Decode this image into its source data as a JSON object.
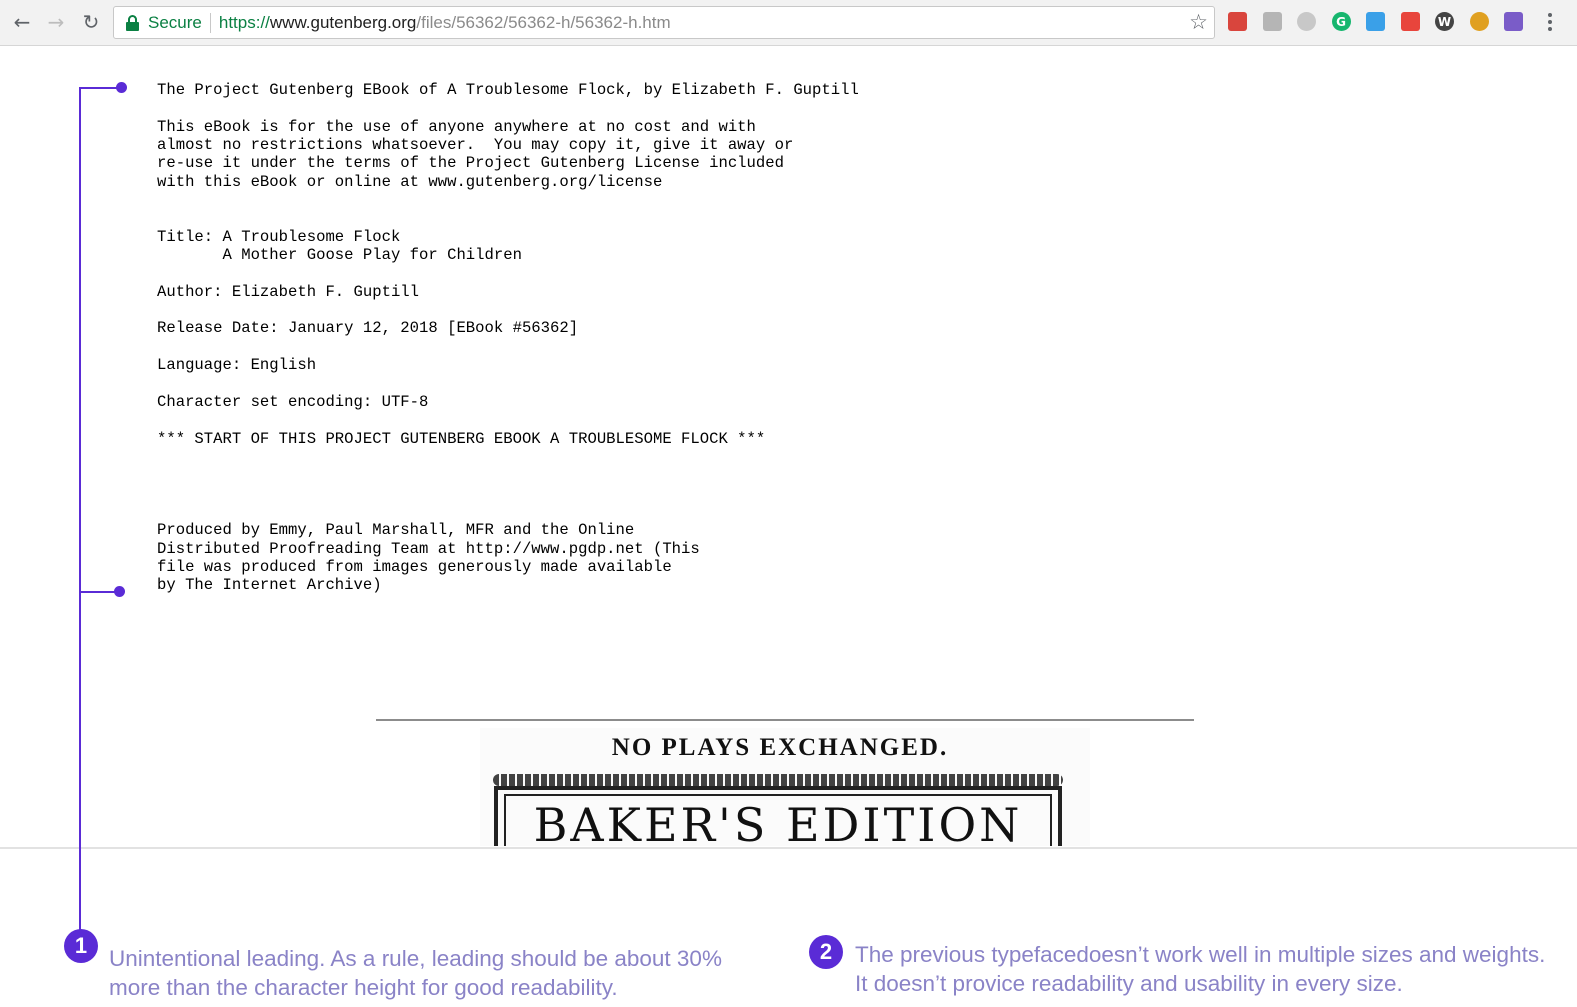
{
  "browser": {
    "secure_label": "Secure",
    "url_scheme": "https://",
    "url_host": "www.gutenberg.org",
    "url_path": "/files/56362/56362-h/56362-h.htm",
    "extensions": [
      {
        "name": "bookmark-red-icon",
        "color": "#d9453d"
      },
      {
        "name": "grey-folder-icon",
        "color": "#b5b5b5"
      },
      {
        "name": "drive-icon",
        "color": "#c8c8c8"
      },
      {
        "name": "grammarly-icon",
        "color": "#16b66e",
        "glyph": "G"
      },
      {
        "name": "notes-icon",
        "color": "#3aa0e8"
      },
      {
        "name": "color-check-icon",
        "color": "#e8453c"
      },
      {
        "name": "wordpress-icon",
        "color": "#444444",
        "glyph": "W"
      },
      {
        "name": "color-wheel-icon",
        "color": "#e0a020"
      },
      {
        "name": "dropper-icon",
        "color": "#7a5cc8"
      }
    ]
  },
  "ebook": {
    "header": "The Project Gutenberg EBook of A Troublesome Flock, by Elizabeth F. Guptill",
    "license": "This eBook is for the use of anyone anywhere at no cost and with\nalmost no restrictions whatsoever.  You may copy it, give it away or\nre-use it under the terms of the Project Gutenberg License included\nwith this eBook or online at www.gutenberg.org/license",
    "title": "Title: A Troublesome Flock\n       A Mother Goose Play for Children",
    "author": "Author: Elizabeth F. Guptill",
    "release": "Release Date: January 12, 2018 [EBook #56362]",
    "language": "Language: English",
    "encoding": "Character set encoding: UTF-8",
    "start_marker": "*** START OF THIS PROJECT GUTENBERG EBOOK A TROUBLESOME FLOCK ***",
    "produced_by": "Produced by Emmy, Paul Marshall, MFR and the Online\nDistributed Proofreading Team at http://www.pgdp.net (This\nfile was produced from images generously made available\nby The Internet Archive)"
  },
  "book_image": {
    "heading": "NO PLAYS EXCHANGED.",
    "title": "BAKER'S EDITION"
  },
  "annotations": [
    {
      "number": "1",
      "text": "Unintentional leading. As a rule, leading should be about 30% more than the character height for good readability."
    },
    {
      "number": "2",
      "text": "The previous typefacedoesn’t work well in multiple sizes and weights. It doesn’t provice readability and usability in every size."
    }
  ],
  "accent_color": "#5a2bd6"
}
